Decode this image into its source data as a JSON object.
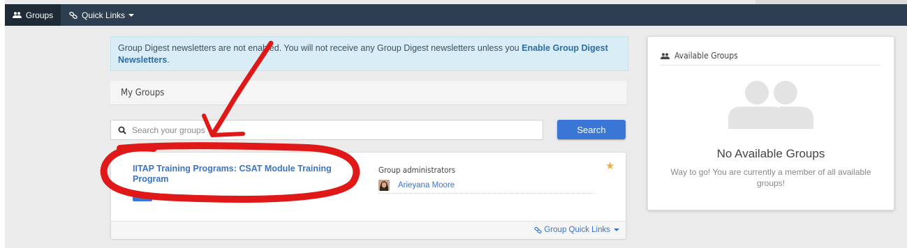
{
  "topnav": {
    "groups_label": "Groups",
    "quick_links_label": "Quick Links"
  },
  "alert": {
    "text": "Group Digest newsletters are not enabled. You will not receive any Group Digest newsletters unless you ",
    "link": "Enable Group Digest Newsletters",
    "suffix": "."
  },
  "my_groups": {
    "header": "My Groups",
    "search_placeholder": "Search your groups",
    "search_button": "Search"
  },
  "group_card": {
    "title": "IITAP Training Programs: CSAT Module Training Program",
    "admins_label": "Group administrators",
    "admin_name": "Arieyana Moore",
    "quick_links": "Group Quick Links",
    "favorite_icon": "star-icon"
  },
  "available_groups": {
    "header": "Available Groups",
    "empty_title": "No Available Groups",
    "empty_text": "Way to go! You are currently a member of all available groups!"
  },
  "colors": {
    "navbar": "#2c3e50",
    "link": "#3a73c8",
    "button": "#3a76d6",
    "alert_bg": "#d9edf7",
    "annotation": "#e01818",
    "star": "#f0ad4e"
  }
}
